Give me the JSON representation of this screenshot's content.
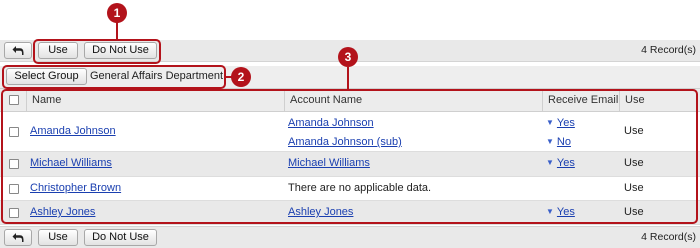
{
  "toolbar_top": {
    "use_label": "Use",
    "do_not_use_label": "Do Not Use",
    "record_count": "4 Record(s)"
  },
  "group": {
    "select_label": "Select Group",
    "name": "General Affairs Department"
  },
  "table": {
    "columns": [
      "Name",
      "Account Name",
      "Receive Email",
      "Use"
    ],
    "rows": [
      {
        "name": "Amanda Johnson",
        "accounts": [
          {
            "account": "Amanda Johnson",
            "email": "Yes",
            "email_caret": true
          },
          {
            "account": "Amanda Johnson (sub)",
            "email": "No",
            "email_caret": true
          }
        ],
        "use": "Use"
      },
      {
        "name": "Michael Williams",
        "accounts": [
          {
            "account": "Michael Williams",
            "email": "Yes",
            "email_caret": true
          }
        ],
        "use": "Use"
      },
      {
        "name": "Christopher Brown",
        "accounts": [
          {
            "account": "There are no applicable data.",
            "email": "",
            "email_caret": false
          }
        ],
        "use": "Use"
      },
      {
        "name": "Ashley Jones",
        "accounts": [
          {
            "account": "Ashley Jones",
            "email": "Yes",
            "email_caret": true
          }
        ],
        "use": "Use"
      }
    ]
  },
  "toolbar_bottom": {
    "use_label": "Use",
    "do_not_use_label": "Do Not Use",
    "record_count": "4 Record(s)"
  },
  "callouts": [
    "1",
    "2",
    "3"
  ],
  "colors": {
    "callout": "#b3131b",
    "link": "#1a3fb0",
    "row_alt": "#e9e9e9",
    "toolbar": "#e9e9e9"
  },
  "icons": {
    "back": "back-arrow-icon",
    "email_dropdown": "caret-down-icon"
  }
}
